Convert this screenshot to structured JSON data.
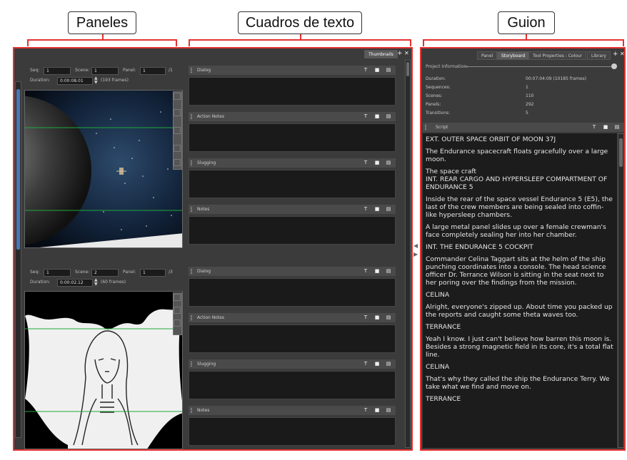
{
  "callouts": {
    "panels": "Paneles",
    "text_boxes": "Cuadros de texto",
    "script": "Guion"
  },
  "left_view": {
    "thumbnails_tab": "Thumbnails",
    "panel1": {
      "seq_label": "Seq:",
      "seq_value": "1",
      "scene_label": "Scene:",
      "scene_value": "1",
      "panel_label": "Panel:",
      "panel_value": "1",
      "panel_total": "/1",
      "duration_label": "Duration:",
      "duration_value": "0:00:08.01",
      "frames": "(193 frames)"
    },
    "panel2": {
      "seq_label": "Seq:",
      "seq_value": "1",
      "scene_label": "Scene:",
      "scene_value": "2",
      "panel_label": "Panel:",
      "panel_value": "1",
      "panel_total": "/3",
      "duration_label": "Duration:",
      "duration_value": "0:00:02.12",
      "frames": "(60 frames)"
    },
    "sections_1": [
      "Dialog",
      "Action Notes",
      "Slugging",
      "Notes"
    ],
    "sections_2": [
      "Dialog",
      "Action Notes",
      "Slugging",
      "Notes"
    ]
  },
  "right_view": {
    "tabs": [
      "Panel",
      "Storyboard",
      "Tool Properties : Colour",
      "Library"
    ],
    "active_tab": "Storyboard",
    "project_info_label": "Project Information:",
    "info": [
      {
        "label": "Duration:",
        "value": "00:07:04:09  (10185 frames)"
      },
      {
        "label": "Sequences:",
        "value": "1"
      },
      {
        "label": "Scenes:",
        "value": "110"
      },
      {
        "label": "Panels:",
        "value": "292"
      },
      {
        "label": "Transitions:",
        "value": "5"
      }
    ],
    "script_label": "Script",
    "script": [
      "EXT. OUTER SPACE ORBIT OF MOON 37J",
      "The Endurance spacecraft floats gracefully over a large moon.",
      "The space craft",
      "INT. REAR CARGO AND HYPERSLEEP COMPARTMENT OF ENDURANCE 5",
      "Inside the rear of the space vessel Endurance 5 (E5), the last of the crew members are being sealed into coffin-like hypersleep chambers.",
      "A large metal panel slides up over a female crewman's face completely sealing her into her chamber.",
      "INT. THE ENDURANCE 5 COCKPIT",
      "Commander Celina Taggart sits at the helm of the ship punching coordinates into a console. The head science officer Dr. Terrance Wilson is sitting in the seat next to her poring over the findings from the mission.",
      "CELINA",
      "Alright, everyone's zipped up. About time you packed up the reports and caught some theta waves too.",
      "TERRANCE",
      "Yeah I know. I just can't believe how barren this moon is. Besides a strong magnetic field in its core, it's a total flat line.",
      "CELINA",
      "That's why they called the ship the Endurance Terry. We take what we find and move on.",
      "TERRANCE"
    ]
  },
  "colors": {
    "highlight": "#e53131",
    "panel_bg": "#3b3b3b",
    "text_box": "#1a1a1a"
  }
}
